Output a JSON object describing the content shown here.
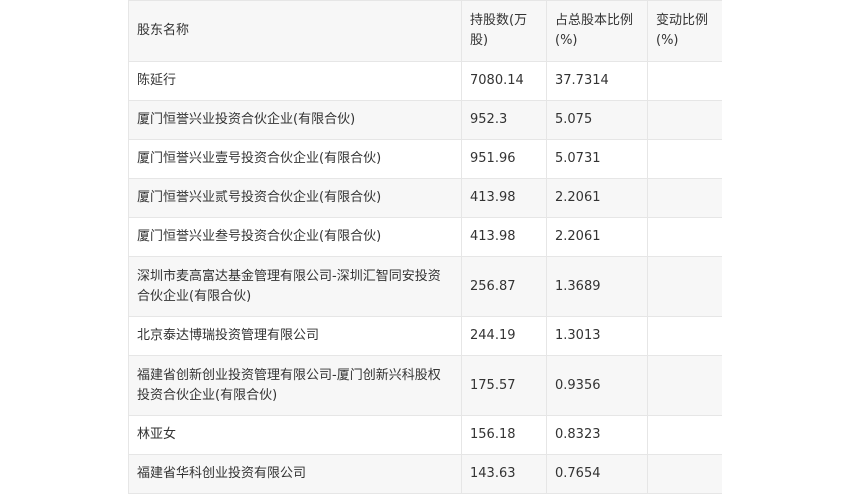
{
  "table": {
    "headers": [
      "股东名称",
      "持股数(万股)",
      "占总股本比例(%)",
      "变动比例(%)"
    ],
    "rows": [
      {
        "name": "陈延行",
        "shares": "7080.14",
        "ratio": "37.7314",
        "change": ""
      },
      {
        "name": "厦门恒誉兴业投资合伙企业(有限合伙)",
        "shares": "952.3",
        "ratio": "5.075",
        "change": ""
      },
      {
        "name": "厦门恒誉兴业壹号投资合伙企业(有限合伙)",
        "shares": "951.96",
        "ratio": "5.0731",
        "change": ""
      },
      {
        "name": "厦门恒誉兴业贰号投资合伙企业(有限合伙)",
        "shares": "413.98",
        "ratio": "2.2061",
        "change": ""
      },
      {
        "name": "厦门恒誉兴业叁号投资合伙企业(有限合伙)",
        "shares": "413.98",
        "ratio": "2.2061",
        "change": ""
      },
      {
        "name": "深圳市麦高富达基金管理有限公司-深圳汇智同安投资合伙企业(有限合伙)",
        "shares": "256.87",
        "ratio": "1.3689",
        "change": ""
      },
      {
        "name": "北京泰达博瑞投资管理有限公司",
        "shares": "244.19",
        "ratio": "1.3013",
        "change": ""
      },
      {
        "name": "福建省创新创业投资管理有限公司-厦门创新兴科股权投资合伙企业(有限合伙)",
        "shares": "175.57",
        "ratio": "0.9356",
        "change": ""
      },
      {
        "name": "林亚女",
        "shares": "156.18",
        "ratio": "0.8323",
        "change": ""
      },
      {
        "name": "福建省华科创业投资有限公司",
        "shares": "143.63",
        "ratio": "0.7654",
        "change": ""
      }
    ]
  }
}
